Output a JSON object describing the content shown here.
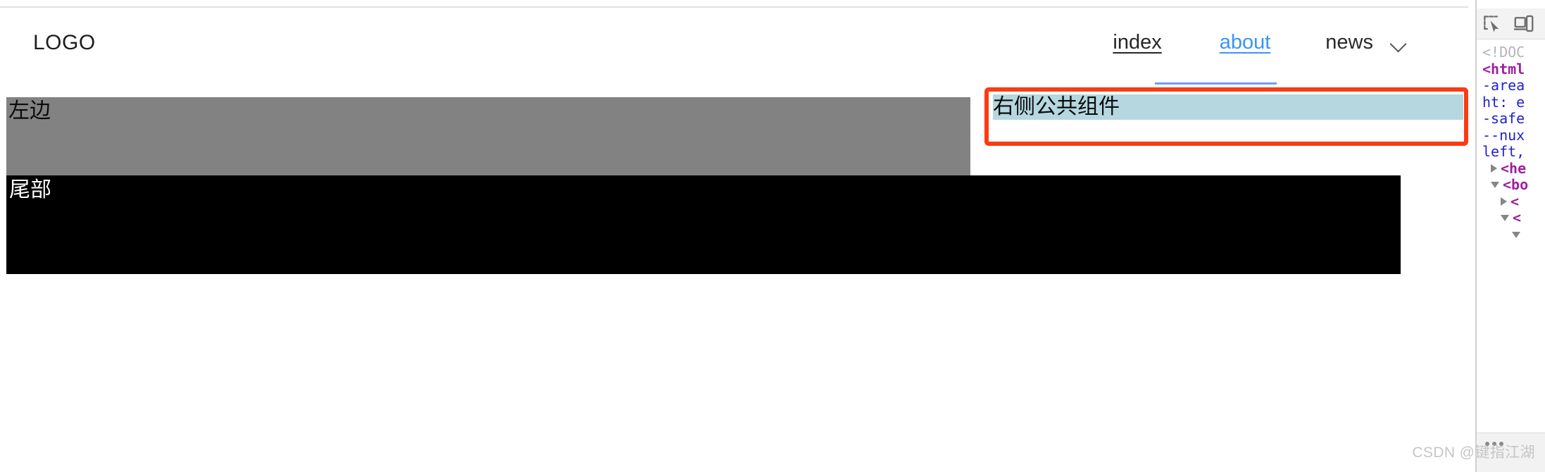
{
  "header": {
    "logo": "LOGO",
    "nav": [
      {
        "label": "index",
        "state": "visited",
        "color": "#262626",
        "underlined": true
      },
      {
        "label": "about",
        "state": "active",
        "color": "#3a95f7",
        "underlined": true
      },
      {
        "label": "news",
        "state": "default",
        "color": "#2a2a2a",
        "underlined": false
      }
    ],
    "news_dropdown_icon": "chevron-down-icon"
  },
  "content": {
    "left_block_label": "左边",
    "left_block_color": "#828282",
    "right_component": {
      "title": "右侧公共组件",
      "title_highlight_color": "#b5d7e0",
      "outline_color": "#fb3b13",
      "body_color": "#ffffff"
    }
  },
  "footer": {
    "label": "尾部",
    "background": "#000000",
    "text_color": "#ffffff"
  },
  "devtools": {
    "toolbar": {
      "inspect_element_icon": "inspect-element-icon",
      "device_toolbar_icon": "device-toolbar-icon"
    },
    "dom_lines": [
      {
        "text": "<!DOC",
        "style": "doctype",
        "indent": 0,
        "marker": "none"
      },
      {
        "text": "<html",
        "style": "tag",
        "indent": 0,
        "marker": "none"
      },
      {
        "text": "-area",
        "style": "attr",
        "indent": 0,
        "marker": "none"
      },
      {
        "text": "ht: e",
        "style": "attr",
        "indent": 0,
        "marker": "none"
      },
      {
        "text": "-safe",
        "style": "attr",
        "indent": 0,
        "marker": "none"
      },
      {
        "text": "--nux",
        "style": "attr",
        "indent": 0,
        "marker": "none"
      },
      {
        "text": "left,",
        "style": "attr",
        "indent": 0,
        "marker": "none"
      },
      {
        "text": "<he",
        "style": "tag",
        "indent": 1,
        "marker": "closed"
      },
      {
        "text": "<bo",
        "style": "tag",
        "indent": 1,
        "marker": "open"
      },
      {
        "text": "<",
        "style": "tag",
        "indent": 2,
        "marker": "closed"
      },
      {
        "text": "<",
        "style": "tag",
        "indent": 2,
        "marker": "open"
      },
      {
        "text": "",
        "style": "plain",
        "indent": 3,
        "marker": "open"
      }
    ],
    "statusbar": {
      "more_label": "more-options-icon"
    }
  },
  "watermark": "CSDN @键指江湖"
}
